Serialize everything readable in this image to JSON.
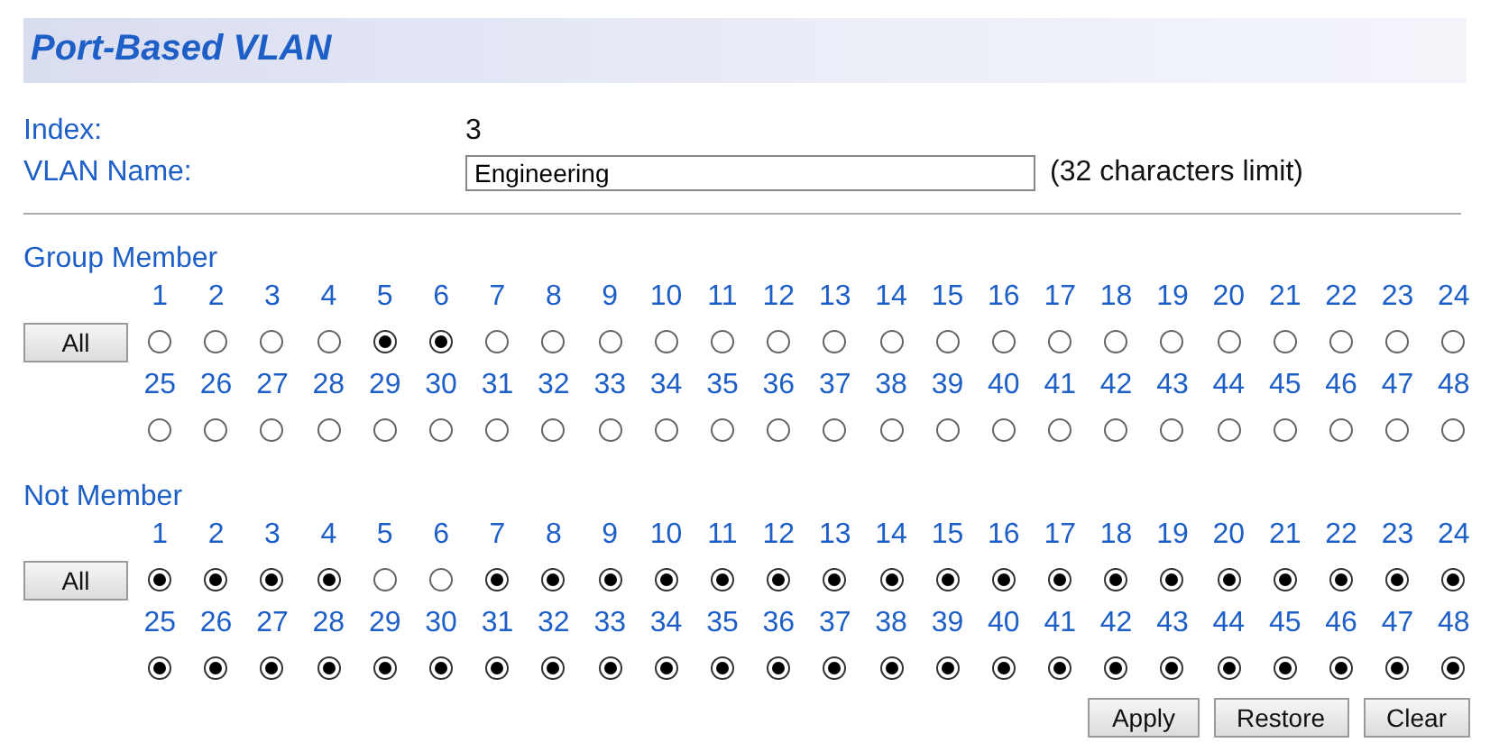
{
  "title": "Port-Based VLAN",
  "index": {
    "label": "Index:",
    "value": "3"
  },
  "vlan_name": {
    "label": "VLAN Name:",
    "value": "Engineering",
    "hint": "(32 characters limit)"
  },
  "groups": [
    {
      "label": "Group Member",
      "button": "All",
      "ports": [
        {
          "number": "1",
          "selected": false
        },
        {
          "number": "2",
          "selected": false
        },
        {
          "number": "3",
          "selected": false
        },
        {
          "number": "4",
          "selected": false
        },
        {
          "number": "5",
          "selected": true
        },
        {
          "number": "6",
          "selected": true
        },
        {
          "number": "7",
          "selected": false
        },
        {
          "number": "8",
          "selected": false
        },
        {
          "number": "9",
          "selected": false
        },
        {
          "number": "10",
          "selected": false
        },
        {
          "number": "11",
          "selected": false
        },
        {
          "number": "12",
          "selected": false
        },
        {
          "number": "13",
          "selected": false
        },
        {
          "number": "14",
          "selected": false
        },
        {
          "number": "15",
          "selected": false
        },
        {
          "number": "16",
          "selected": false
        },
        {
          "number": "17",
          "selected": false
        },
        {
          "number": "18",
          "selected": false
        },
        {
          "number": "19",
          "selected": false
        },
        {
          "number": "20",
          "selected": false
        },
        {
          "number": "21",
          "selected": false
        },
        {
          "number": "22",
          "selected": false
        },
        {
          "number": "23",
          "selected": false
        },
        {
          "number": "24",
          "selected": false
        },
        {
          "number": "25",
          "selected": false
        },
        {
          "number": "26",
          "selected": false
        },
        {
          "number": "27",
          "selected": false
        },
        {
          "number": "28",
          "selected": false
        },
        {
          "number": "29",
          "selected": false
        },
        {
          "number": "30",
          "selected": false
        },
        {
          "number": "31",
          "selected": false
        },
        {
          "number": "32",
          "selected": false
        },
        {
          "number": "33",
          "selected": false
        },
        {
          "number": "34",
          "selected": false
        },
        {
          "number": "35",
          "selected": false
        },
        {
          "number": "36",
          "selected": false
        },
        {
          "number": "37",
          "selected": false
        },
        {
          "number": "38",
          "selected": false
        },
        {
          "number": "39",
          "selected": false
        },
        {
          "number": "40",
          "selected": false
        },
        {
          "number": "41",
          "selected": false
        },
        {
          "number": "42",
          "selected": false
        },
        {
          "number": "43",
          "selected": false
        },
        {
          "number": "44",
          "selected": false
        },
        {
          "number": "45",
          "selected": false
        },
        {
          "number": "46",
          "selected": false
        },
        {
          "number": "47",
          "selected": false
        },
        {
          "number": "48",
          "selected": false
        }
      ]
    },
    {
      "label": "Not Member",
      "button": "All",
      "ports": [
        {
          "number": "1",
          "selected": true
        },
        {
          "number": "2",
          "selected": true
        },
        {
          "number": "3",
          "selected": true
        },
        {
          "number": "4",
          "selected": true
        },
        {
          "number": "5",
          "selected": false
        },
        {
          "number": "6",
          "selected": false
        },
        {
          "number": "7",
          "selected": true
        },
        {
          "number": "8",
          "selected": true
        },
        {
          "number": "9",
          "selected": true
        },
        {
          "number": "10",
          "selected": true
        },
        {
          "number": "11",
          "selected": true
        },
        {
          "number": "12",
          "selected": true
        },
        {
          "number": "13",
          "selected": true
        },
        {
          "number": "14",
          "selected": true
        },
        {
          "number": "15",
          "selected": true
        },
        {
          "number": "16",
          "selected": true
        },
        {
          "number": "17",
          "selected": true
        },
        {
          "number": "18",
          "selected": true
        },
        {
          "number": "19",
          "selected": true
        },
        {
          "number": "20",
          "selected": true
        },
        {
          "number": "21",
          "selected": true
        },
        {
          "number": "22",
          "selected": true
        },
        {
          "number": "23",
          "selected": true
        },
        {
          "number": "24",
          "selected": true
        },
        {
          "number": "25",
          "selected": true
        },
        {
          "number": "26",
          "selected": true
        },
        {
          "number": "27",
          "selected": true
        },
        {
          "number": "28",
          "selected": true
        },
        {
          "number": "29",
          "selected": true
        },
        {
          "number": "30",
          "selected": true
        },
        {
          "number": "31",
          "selected": true
        },
        {
          "number": "32",
          "selected": true
        },
        {
          "number": "33",
          "selected": true
        },
        {
          "number": "34",
          "selected": true
        },
        {
          "number": "35",
          "selected": true
        },
        {
          "number": "36",
          "selected": true
        },
        {
          "number": "37",
          "selected": true
        },
        {
          "number": "38",
          "selected": true
        },
        {
          "number": "39",
          "selected": true
        },
        {
          "number": "40",
          "selected": true
        },
        {
          "number": "41",
          "selected": true
        },
        {
          "number": "42",
          "selected": true
        },
        {
          "number": "43",
          "selected": true
        },
        {
          "number": "44",
          "selected": true
        },
        {
          "number": "45",
          "selected": true
        },
        {
          "number": "46",
          "selected": true
        },
        {
          "number": "47",
          "selected": true
        },
        {
          "number": "48",
          "selected": true
        }
      ]
    }
  ],
  "buttons": [
    "Apply",
    "Restore",
    "Clear"
  ]
}
